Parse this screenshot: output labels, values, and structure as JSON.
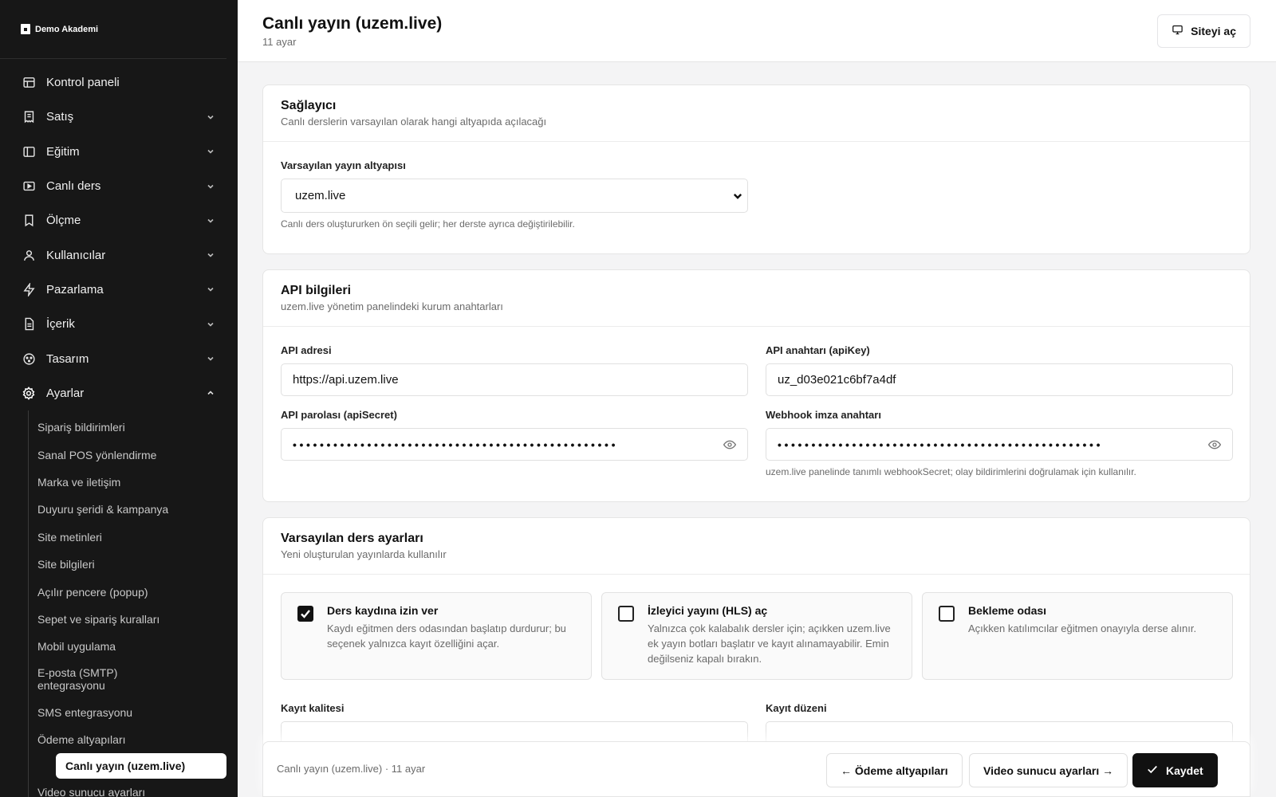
{
  "brand": {
    "name": "Demo Akademi"
  },
  "sidebar": {
    "items": [
      {
        "label": "Kontrol paneli",
        "icon": "dashboard-icon",
        "chevron": ""
      },
      {
        "label": "Satış",
        "icon": "receipt-icon",
        "chevron": "down"
      },
      {
        "label": "Eğitim",
        "icon": "book-icon",
        "chevron": "down"
      },
      {
        "label": "Canlı ders",
        "icon": "video-icon",
        "chevron": "down"
      },
      {
        "label": "Ölçme",
        "icon": "bookmark-icon",
        "chevron": "down"
      },
      {
        "label": "Kullanıcılar",
        "icon": "user-icon",
        "chevron": "down"
      },
      {
        "label": "Pazarlama",
        "icon": "bolt-icon",
        "chevron": "down"
      },
      {
        "label": "İçerik",
        "icon": "document-icon",
        "chevron": "down"
      },
      {
        "label": "Tasarım",
        "icon": "palette-icon",
        "chevron": "down"
      },
      {
        "label": "Ayarlar",
        "icon": "gear-icon",
        "chevron": "up"
      }
    ],
    "sub_items": [
      "Sipariş bildirimleri",
      "Sanal POS yönlendirme",
      "Marka ve iletişim",
      "Duyuru şeridi & kampanya",
      "Site metinleri",
      "Site bilgileri",
      "Açılır pencere (popup)",
      "Sepet ve sipariş kuralları",
      "Mobil uygulama",
      "E-posta (SMTP) entegrasyonu",
      "SMS entegrasyonu",
      "Ödeme altyapıları",
      "Canlı yayın (uzem.live)",
      "Video sunucu ayarları"
    ]
  },
  "header": {
    "title": "Canlı yayın (uzem.live)",
    "subtitle": "11 ayar",
    "open_site": "Siteyi aç"
  },
  "provider": {
    "title": "Sağlayıcı",
    "desc": "Canlı derslerin varsayılan olarak hangi altyapıda açılacağı",
    "field_label": "Varsayılan yayın altyapısı",
    "selected": "uzem.live",
    "hint": "Canlı ders oluştururken ön seçili gelir; her derste ayrıca değiştirilebilir."
  },
  "api": {
    "title": "API bilgileri",
    "desc": "uzem.live yönetim panelindeki kurum anahtarları",
    "address_label": "API adresi",
    "address_value": "https://api.uzem.live",
    "key_label": "API anahtarı (apiKey)",
    "key_value": "uz_d03e021c6bf7a4df",
    "secret_label": "API parolası (apiSecret)",
    "secret_value": "••••••••••••••••••••••••••••••••••••••••••••••••",
    "webhook_label": "Webhook imza anahtarı",
    "webhook_value": "••••••••••••••••••••••••••••••••••••••••••••••••",
    "webhook_hint": "uzem.live panelinde tanımlı webhookSecret; olay bildirimlerini doğrulamak için kullanılır."
  },
  "defaults": {
    "title": "Varsayılan ders ayarları",
    "desc": "Yeni oluşturulan yayınlarda kullanılır",
    "options": [
      {
        "title": "Ders kaydına izin ver",
        "desc": "Kaydı eğitmen ders odasından başlatıp durdurur; bu seçenek yalnızca kayıt özelliğini açar.",
        "checked": true
      },
      {
        "title": "İzleyici yayını (HLS) aç",
        "desc": "Yalnızca çok kalabalık dersler için; açıkken uzem.live ek yayın botları başlatır ve kayıt alınamayabilir. Emin değilseniz kapalı bırakın.",
        "checked": false
      },
      {
        "title": "Bekleme odası",
        "desc": "Açıkken katılımcılar eğitmen onayıyla derse alınır.",
        "checked": false
      }
    ],
    "quality_label": "Kayıt kalitesi",
    "layout_label": "Kayıt düzeni"
  },
  "footer": {
    "text": "Canlı yayın (uzem.live) · 11 ayar",
    "prev": "← Ödeme altyapıları",
    "next": "Video sunucu ayarları →",
    "save": "Kaydet"
  }
}
